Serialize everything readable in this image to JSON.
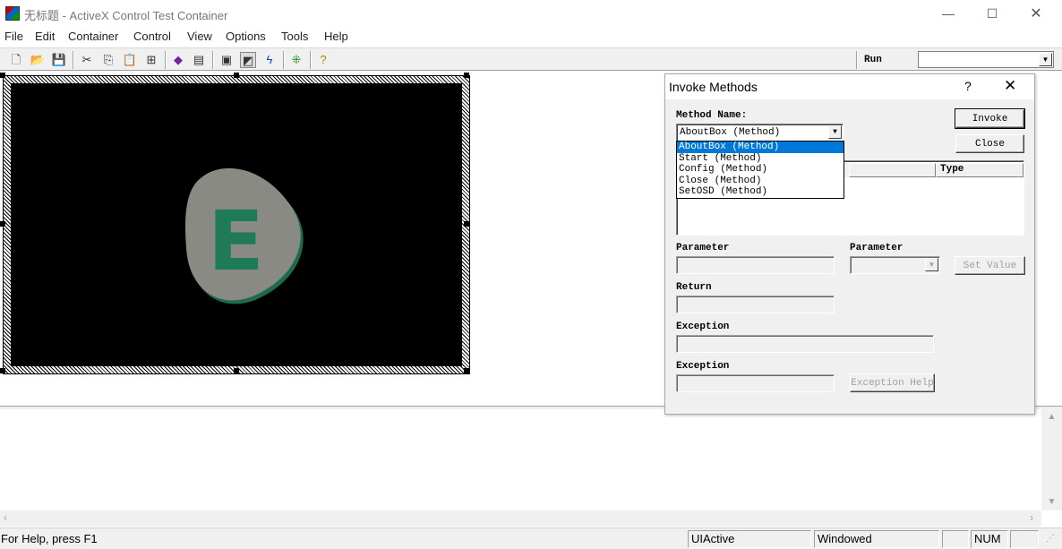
{
  "window": {
    "title": "无标题 - ActiveX Control Test Container",
    "min_glyph": "—",
    "max_glyph": "☐",
    "close_glyph": "✕"
  },
  "menu": [
    "File",
    "Edit",
    "Container",
    "Control",
    "View",
    "Options",
    "Tools",
    "Help"
  ],
  "toolbar": {
    "icons": [
      "new-icon",
      "open-icon",
      "save-icon",
      "cut-icon",
      "copy-icon",
      "paste-icon",
      "insert-control-icon",
      "invoke-methods-icon",
      "properties-icon",
      "events-icon",
      "passive-icon",
      "macro-icon",
      "grid-icon",
      "help-icon"
    ],
    "run_label": "Run",
    "run_value": ""
  },
  "control": {
    "logo_letter": "E",
    "logo_colors": {
      "background": "#000000",
      "shape": "#8a8a84",
      "letter": "#1f7a5a"
    }
  },
  "status": {
    "help": "For Help, press F1",
    "state": "UIActive",
    "mode": "Windowed",
    "num": "NUM"
  },
  "dialog": {
    "title": "Invoke Methods",
    "help_glyph": "?",
    "close_glyph": "✕",
    "method_name_label": "Method Name:",
    "method_selected": "AboutBox (Method)",
    "method_options": [
      "AboutBox (Method)",
      "Start (Method)",
      "Config (Method)",
      "Close (Method)",
      "SetOSD (Method)"
    ],
    "selected_index": 0,
    "invoke_label": "Invoke",
    "close_label": "Close",
    "param_column_type": "Type",
    "parameter_label_1": "Parameter",
    "parameter_label_2": "Parameter",
    "set_value_label": "Set Value",
    "return_label": "Return",
    "exception_label_1": "Exception",
    "exception_label_2": "Exception",
    "exception_help_label": "Exception Help"
  }
}
